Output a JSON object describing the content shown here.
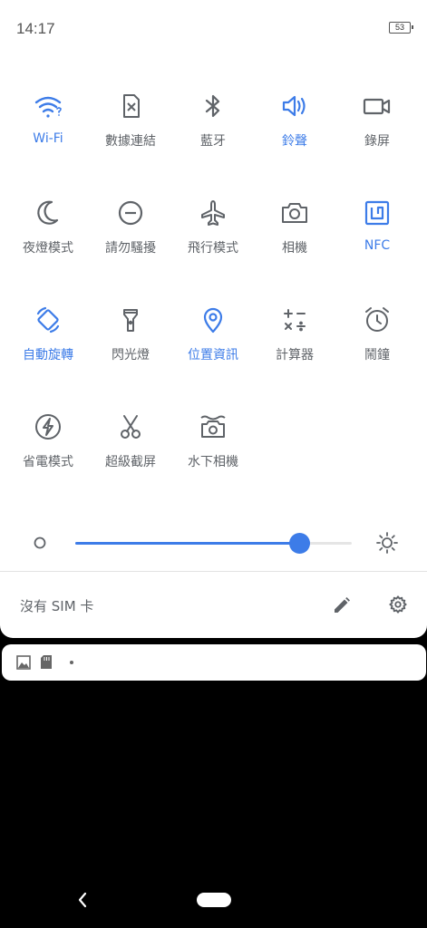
{
  "status": {
    "time": "14:17",
    "battery": "53"
  },
  "tiles": [
    {
      "label": "Wi-Fi",
      "icon": "wifi-icon",
      "active": true
    },
    {
      "label": "數據連結",
      "icon": "sim-card-x-icon",
      "active": false
    },
    {
      "label": "藍牙",
      "icon": "bluetooth-icon",
      "active": false
    },
    {
      "label": "鈴聲",
      "icon": "volume-icon",
      "active": true
    },
    {
      "label": "錄屏",
      "icon": "video-camera-icon",
      "active": false
    },
    {
      "label": "夜燈模式",
      "icon": "moon-icon",
      "active": false
    },
    {
      "label": "請勿騷擾",
      "icon": "do-not-disturb-icon",
      "active": false
    },
    {
      "label": "飛行模式",
      "icon": "airplane-icon",
      "active": false
    },
    {
      "label": "相機",
      "icon": "camera-icon",
      "active": false
    },
    {
      "label": "NFC",
      "icon": "nfc-icon",
      "active": true
    },
    {
      "label": "自動旋轉",
      "icon": "rotate-icon",
      "active": true
    },
    {
      "label": "閃光燈",
      "icon": "flashlight-icon",
      "active": false
    },
    {
      "label": "位置資訊",
      "icon": "location-pin-icon",
      "active": true
    },
    {
      "label": "計算器",
      "icon": "calculator-icon",
      "active": false
    },
    {
      "label": "鬧鐘",
      "icon": "alarm-clock-icon",
      "active": false
    },
    {
      "label": "省電模式",
      "icon": "battery-saver-icon",
      "active": false
    },
    {
      "label": "超級截屏",
      "icon": "scissors-icon",
      "active": false
    },
    {
      "label": "水下相機",
      "icon": "underwater-camera-icon",
      "active": false
    }
  ],
  "brightness": {
    "level": 0.81
  },
  "footer": {
    "sim_text": "沒有 SIM 卡"
  },
  "colors": {
    "accent": "#3d7ce8",
    "icon_gray": "#5f6368",
    "background": "#ffffff"
  }
}
